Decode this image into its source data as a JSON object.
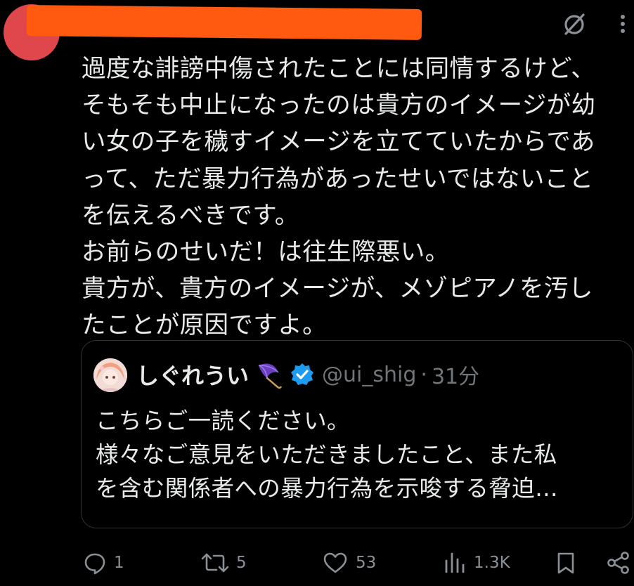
{
  "tweet": {
    "lines": [
      "過度な誹謗中傷されたことには同情するけど、",
      "そもそも中止になったのは貴方のイメージが幼",
      "い女の子を穢すイメージを立てていたからであ",
      "って、ただ暴力行為があったせいではないこと",
      "を伝えるべきです。",
      "お前らのせいだ！は往生際悪い。",
      "貴方が、貴方のイメージが、メゾピアノを汚し",
      "たことが原因ですよ。"
    ]
  },
  "quote": {
    "name": "しぐれうい",
    "name_emoji_icon": "umbrella-icon",
    "verified_icon": "verified-badge-icon",
    "handle": "@ui_shig",
    "separator": "·",
    "time": "31分",
    "lines": [
      "こちらご一読ください。",
      "様々なご意見をいただきましたこと、また私",
      "を含む関係者への暴力行為を示唆する脅迫…"
    ]
  },
  "actions": {
    "reply_count": "1",
    "retweet_count": "5",
    "like_count": "53",
    "views_count": "1.3K"
  },
  "colors": {
    "background": "#000000",
    "text": "#e7e9ea",
    "muted": "#71767b",
    "avatar": "#e0474c",
    "redaction": "#ff5a0f",
    "verified": "#1d9bf0",
    "quote_border": "#2f3336"
  }
}
